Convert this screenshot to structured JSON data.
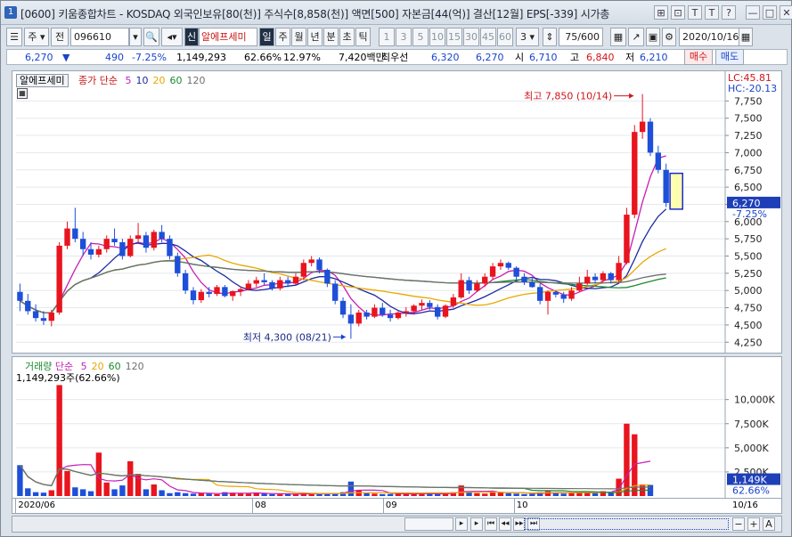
{
  "window": {
    "badge": "1",
    "title": "[0600] 키움종합차트 - KOSDAQ 외국인보유[80(천)] 주식수[8,858(천)] 액면[500] 자본금[44(억)] 결산[12월] EPS[-339] 시가총"
  },
  "titlebar_buttons": [
    {
      "name": "window-list-icon",
      "glyph": "⊞"
    },
    {
      "name": "link-icon",
      "glyph": "⊡"
    },
    {
      "name": "pin-icon",
      "glyph": "T"
    },
    {
      "name": "text-icon",
      "glyph": "T"
    },
    {
      "name": "help-icon",
      "glyph": "?"
    },
    {
      "name": "minimize-icon",
      "glyph": "—"
    },
    {
      "name": "maximize-icon",
      "glyph": "□"
    },
    {
      "name": "close-icon",
      "glyph": "✕"
    }
  ],
  "toolbar": {
    "mode_left": "주",
    "mode_prev": "전",
    "stock_code": "096610",
    "stock_name": "알에프세미",
    "sin_label": "신",
    "periods": [
      "일",
      "주",
      "월",
      "년",
      "분",
      "초",
      "틱"
    ],
    "active_period": "일",
    "intervals": [
      "1",
      "3",
      "5",
      "10",
      "15",
      "30",
      "45",
      "60"
    ],
    "interval_value": "3",
    "page_count": "75/600",
    "date": "2020/10/16"
  },
  "quote": {
    "price": "6,270",
    "arrow": "▼",
    "change": "490",
    "change_pct": "-7.25%",
    "volume": "1,149,293",
    "vol_ratio": "62.66%",
    "turnover": "12.97%",
    "amount": "7,420백만",
    "best_label": "최우선",
    "ask": "6,320",
    "bid": "6,270",
    "open_label": "시",
    "open": "6,710",
    "high_label": "고",
    "high": "6,840",
    "low_label": "저",
    "low": "6,210",
    "buy_label": "매수",
    "sell_label": "매도"
  },
  "price_panel": {
    "stock_label": "알에프세미",
    "ma_legend_prefix": "종가 단순",
    "ma_periods": [
      "5",
      "10",
      "20",
      "60",
      "120"
    ],
    "ma_colors": [
      "#c81eb4",
      "#1c2aa0",
      "#e8a800",
      "#1a8a2e",
      "#707070"
    ],
    "lc_text": "LC:45.81",
    "hc_text": "HC:-20.13",
    "high_annotation": "최고 7,850 (10/14)",
    "low_annotation": "최저 4,300 (08/21)",
    "current_price_tag": "6,270",
    "current_pct_tag": "-7.25%"
  },
  "volume_panel": {
    "legend_label": "거래량",
    "legend_ma_prefix": "단순",
    "ma_periods": [
      "5",
      "20",
      "60",
      "120"
    ],
    "current_text": "1,149,293주(62.66%)",
    "current_tag": "1,149K",
    "current_pct": "62.66%"
  },
  "x_axis_labels": [
    {
      "text": "2020/06",
      "index": 0
    },
    {
      "text": "08",
      "index": 38
    },
    {
      "text": "09",
      "index": 59
    },
    {
      "text": "10",
      "index": 80
    },
    {
      "text": "10/16",
      "index": 105
    }
  ],
  "colors": {
    "up": "#e8141e",
    "down": "#1e4fd8",
    "accent": "#1f2f44"
  },
  "chart_data": [
    {
      "type": "candlestick",
      "title": "",
      "ylim": [
        4150,
        8000
      ],
      "y_ticks": [
        4250,
        4500,
        4750,
        5000,
        5250,
        5500,
        5750,
        6000,
        6250,
        6500,
        6750,
        7000,
        7250,
        7500,
        7750
      ],
      "candles": [
        [
          4980,
          5100,
          4700,
          4850
        ],
        [
          4850,
          4950,
          4650,
          4700
        ],
        [
          4700,
          4800,
          4550,
          4600
        ],
        [
          4600,
          4700,
          4500,
          4560
        ],
        [
          4560,
          4720,
          4480,
          4680
        ],
        [
          4680,
          5700,
          4650,
          5650
        ],
        [
          5650,
          6000,
          5600,
          5900
        ],
        [
          5900,
          6200,
          5700,
          5750
        ],
        [
          5750,
          5850,
          5500,
          5600
        ],
        [
          5600,
          5700,
          5450,
          5520
        ],
        [
          5520,
          5650,
          5480,
          5600
        ],
        [
          5600,
          5800,
          5550,
          5750
        ],
        [
          5750,
          5900,
          5650,
          5700
        ],
        [
          5700,
          5750,
          5450,
          5500
        ],
        [
          5500,
          5800,
          5480,
          5750
        ],
        [
          5750,
          5980,
          5700,
          5800
        ],
        [
          5800,
          5850,
          5550,
          5620
        ],
        [
          5620,
          5880,
          5580,
          5850
        ],
        [
          5850,
          5950,
          5700,
          5750
        ],
        [
          5750,
          5800,
          5450,
          5500
        ],
        [
          5500,
          5550,
          5200,
          5250
        ],
        [
          5250,
          5300,
          4950,
          5000
        ],
        [
          5000,
          5050,
          4800,
          4860
        ],
        [
          4860,
          5020,
          4820,
          4980
        ],
        [
          4980,
          5050,
          4900,
          4950
        ],
        [
          4950,
          5080,
          4920,
          5050
        ],
        [
          5050,
          5080,
          4900,
          4920
        ],
        [
          4920,
          5000,
          4850,
          4990
        ],
        [
          4990,
          5060,
          4920,
          5020
        ],
        [
          5020,
          5150,
          5000,
          5100
        ],
        [
          5100,
          5200,
          5050,
          5150
        ],
        [
          5150,
          5250,
          5080,
          5120
        ],
        [
          5120,
          5150,
          5000,
          5030
        ],
        [
          5030,
          5200,
          5000,
          5150
        ],
        [
          5150,
          5200,
          5050,
          5100
        ],
        [
          5100,
          5250,
          5080,
          5200
        ],
        [
          5200,
          5450,
          5150,
          5400
        ],
        [
          5400,
          5500,
          5350,
          5450
        ],
        [
          5450,
          5480,
          5250,
          5300
        ],
        [
          5300,
          5320,
          5050,
          5100
        ],
        [
          5100,
          5150,
          4800,
          4850
        ],
        [
          4850,
          4900,
          4600,
          4650
        ],
        [
          4650,
          4800,
          4300,
          4520
        ],
        [
          4520,
          4720,
          4480,
          4680
        ],
        [
          4680,
          4720,
          4580,
          4620
        ],
        [
          4620,
          4800,
          4600,
          4750
        ],
        [
          4750,
          4820,
          4620,
          4650
        ],
        [
          4650,
          4720,
          4550,
          4600
        ],
        [
          4600,
          4700,
          4580,
          4680
        ],
        [
          4680,
          4760,
          4620,
          4700
        ],
        [
          4700,
          4800,
          4650,
          4780
        ],
        [
          4780,
          4870,
          4720,
          4820
        ],
        [
          4820,
          4860,
          4720,
          4760
        ],
        [
          4760,
          4800,
          4580,
          4620
        ],
        [
          4620,
          4800,
          4600,
          4780
        ],
        [
          4780,
          4950,
          4750,
          4900
        ],
        [
          4900,
          5250,
          4880,
          5150
        ],
        [
          5150,
          5200,
          4950,
          5000
        ],
        [
          5000,
          5150,
          4980,
          5100
        ],
        [
          5100,
          5250,
          5050,
          5200
        ],
        [
          5200,
          5400,
          5150,
          5350
        ],
        [
          5350,
          5450,
          5300,
          5400
        ],
        [
          5400,
          5420,
          5300,
          5330
        ],
        [
          5330,
          5350,
          5150,
          5200
        ],
        [
          5200,
          5250,
          5080,
          5120
        ],
        [
          5120,
          5200,
          5040,
          5050
        ],
        [
          5050,
          5100,
          4800,
          4850
        ],
        [
          4850,
          5000,
          4650,
          4980
        ],
        [
          4980,
          5000,
          4900,
          4940
        ],
        [
          4940,
          4980,
          4820,
          4880
        ],
        [
          4880,
          5050,
          4850,
          5000
        ],
        [
          5000,
          5200,
          4980,
          5100
        ],
        [
          5100,
          5300,
          5080,
          5200
        ],
        [
          5200,
          5250,
          5100,
          5150
        ],
        [
          5150,
          5280,
          5120,
          5250
        ],
        [
          5250,
          5270,
          5100,
          5150
        ],
        [
          5150,
          5500,
          5120,
          5400
        ],
        [
          5400,
          6200,
          5380,
          6100
        ],
        [
          6100,
          7400,
          6050,
          7300
        ],
        [
          7300,
          7850,
          7200,
          7450
        ],
        [
          7450,
          7500,
          6950,
          7000
        ],
        [
          7000,
          7100,
          6700,
          6750
        ],
        [
          6750,
          6840,
          6210,
          6270
        ]
      ],
      "volume_ylim": [
        0,
        12000000
      ],
      "volume_ticks": [
        2500000,
        5000000,
        7500000,
        10000000
      ],
      "volume_tick_labels": [
        "2,500K",
        "5,000K",
        "7,500K",
        "10,000K"
      ],
      "volumes": [
        3200000,
        800000,
        400000,
        350000,
        600000,
        11500000,
        2600000,
        900000,
        700000,
        500000,
        4500000,
        1400000,
        700000,
        1100000,
        3600000,
        2300000,
        700000,
        1200000,
        600000,
        300000,
        400000,
        300000,
        250000,
        300000,
        250000,
        200000,
        400000,
        350000,
        300000,
        250000,
        300000,
        250000,
        200000,
        180000,
        220000,
        200000,
        300000,
        250000,
        200000,
        220000,
        300000,
        400000,
        1500000,
        600000,
        300000,
        250000,
        200000,
        220000,
        300000,
        200000,
        250000,
        220000,
        300000,
        200000,
        250000,
        400000,
        1100000,
        400000,
        300000,
        250000,
        500000,
        400000,
        300000,
        250000,
        200000,
        220000,
        400000,
        500000,
        300000,
        250000,
        300000,
        400000,
        450000,
        300000,
        500000,
        400000,
        1800000,
        7500000,
        6400000,
        1200000,
        1149293
      ]
    }
  ]
}
